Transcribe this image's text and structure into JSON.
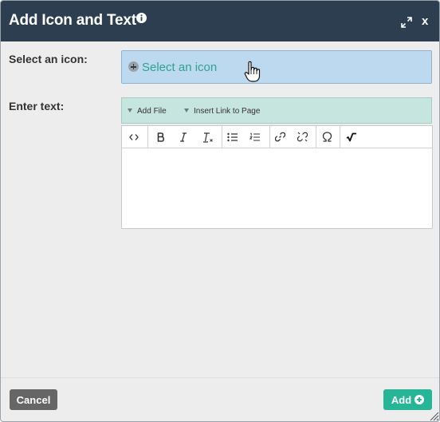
{
  "dialog": {
    "title": "Add Icon and Text",
    "close_label": "x",
    "icons": [
      "info-icon",
      "expand-icon"
    ]
  },
  "icon_field": {
    "label": "Select an icon:",
    "button_text": "Select an icon"
  },
  "text_field": {
    "label": "Enter text:",
    "link_buttons": [
      "Add File",
      "Insert Link to Page"
    ],
    "toolbar": [
      "source-code-icon",
      "bold-icon",
      "italic-icon",
      "remove-format-icon",
      "bulleted-list-icon",
      "numbered-list-icon",
      "link-icon",
      "unlink-icon",
      "special-character-icon",
      "math-formula-icon"
    ],
    "content": ""
  },
  "footer": {
    "cancel_label": "Cancel",
    "add_label": "Add"
  },
  "colors": {
    "titlebar": "#2c3e50",
    "icon_select_bg": "#bdd9ef",
    "icon_select_text": "#2ea38f",
    "link_bar_bg": "#c6e5df",
    "add_button": "#26b596",
    "cancel_button": "#666666"
  }
}
